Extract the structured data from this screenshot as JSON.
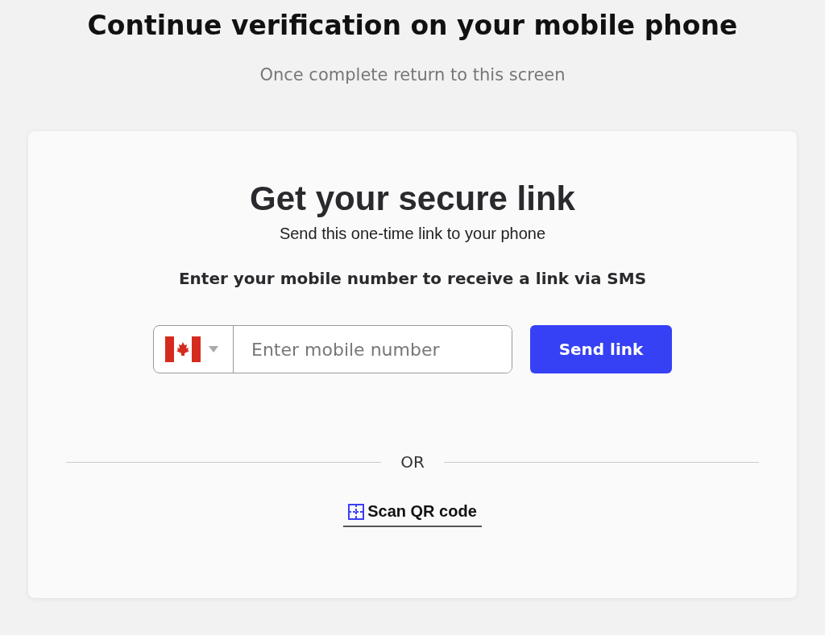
{
  "title": "Continue verification on your mobile phone",
  "subtitle": "Once complete return to this screen",
  "card": {
    "heading": "Get your secure link",
    "subheading": "Send this one-time link to your phone",
    "instruction": "Enter your mobile number to receive a link via SMS",
    "phone_field": {
      "placeholder": "Enter mobile number"
    },
    "send_button": "Send link",
    "divider": "OR",
    "qr_link": "Scan QR code"
  }
}
